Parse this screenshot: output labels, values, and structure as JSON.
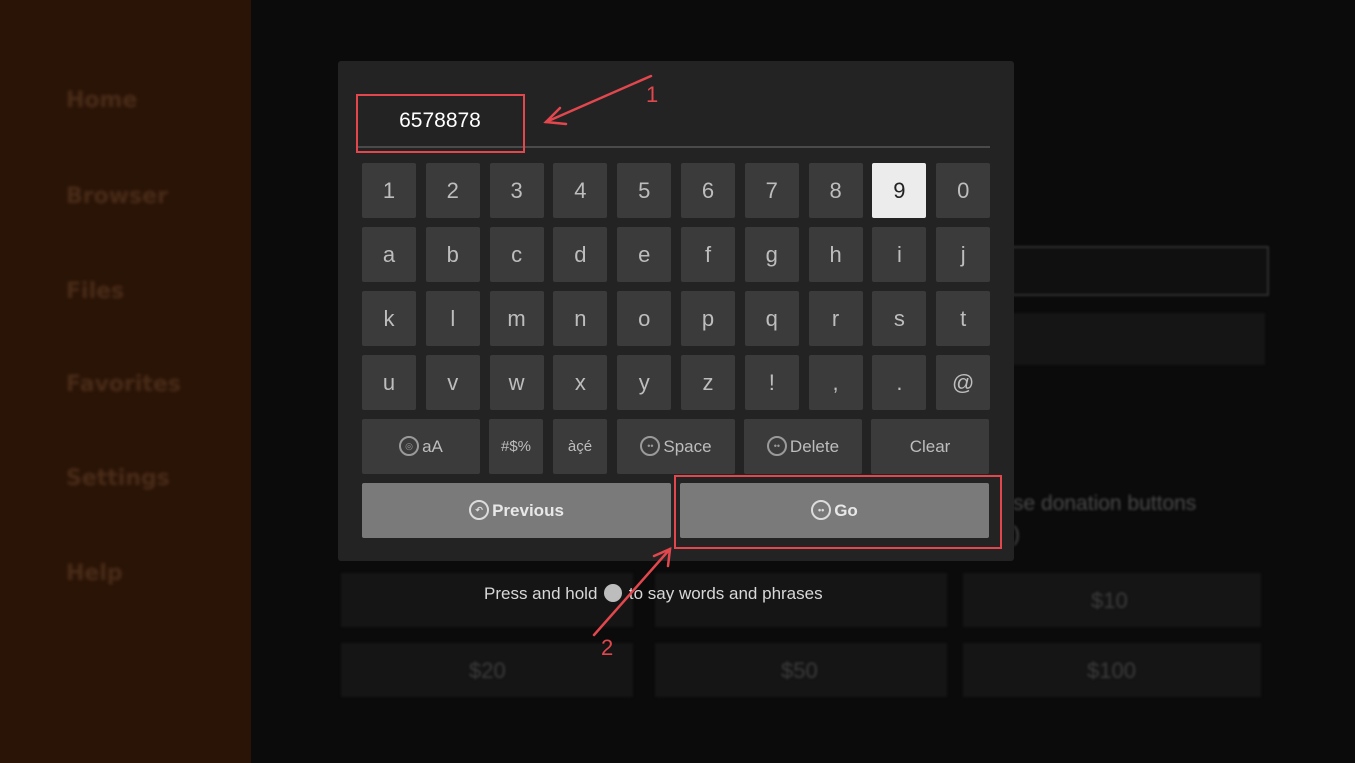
{
  "sidebar": {
    "items": [
      "Home",
      "Browser",
      "Files",
      "Favorites",
      "Settings",
      "Help"
    ]
  },
  "background": {
    "donation_text": "se donation buttons",
    "donation_text_2": ")",
    "amounts": [
      "$10",
      "$20",
      "$50",
      "$100"
    ]
  },
  "keyboard": {
    "input_value": "6578878",
    "rows": [
      [
        "1",
        "2",
        "3",
        "4",
        "5",
        "6",
        "7",
        "8",
        "9",
        "0"
      ],
      [
        "a",
        "b",
        "c",
        "d",
        "e",
        "f",
        "g",
        "h",
        "i",
        "j"
      ],
      [
        "k",
        "l",
        "m",
        "n",
        "o",
        "p",
        "q",
        "r",
        "s",
        "t"
      ],
      [
        "u",
        "v",
        "w",
        "x",
        "y",
        "z",
        "!",
        ",",
        ".",
        "@"
      ]
    ],
    "selected_key": "9",
    "fn_keys": {
      "case": "aA",
      "symbols": "#$%",
      "accents": "àçé",
      "space": "Space",
      "delete": "Delete",
      "clear": "Clear"
    },
    "previous": "Previous",
    "go": "Go",
    "hint_before": "Press and hold",
    "hint_after": "to say words and phrases"
  },
  "annotations": {
    "label_1": "1",
    "label_2": "2",
    "color": "#e2474e"
  }
}
